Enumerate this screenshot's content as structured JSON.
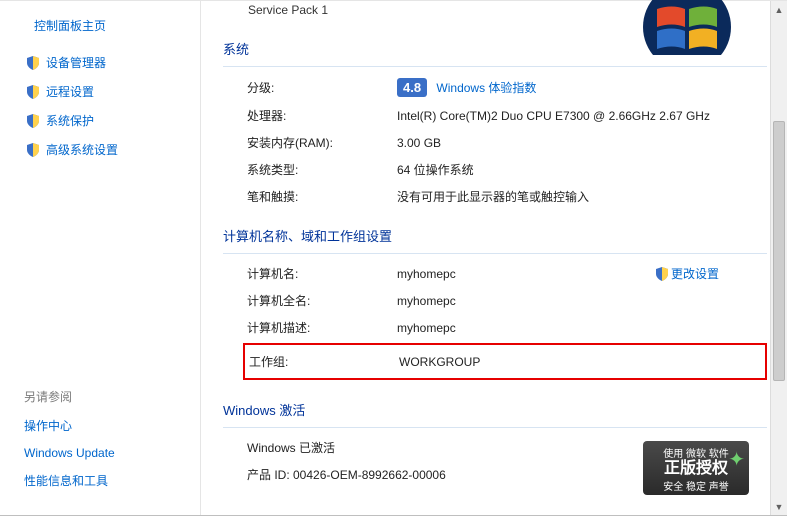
{
  "sidebar": {
    "home": "控制面板主页",
    "links": [
      "设备管理器",
      "远程设置",
      "系统保护",
      "高级系统设置"
    ],
    "see_also": "另请参阅",
    "bottom": [
      "操作中心",
      "Windows Update",
      "性能信息和工具"
    ]
  },
  "top_partial": "Service Pack 1",
  "sections": {
    "system": {
      "header": "系统",
      "rating_label": "分级:",
      "rating_value": "4.8",
      "rating_link": "Windows 体验指数",
      "rows": [
        {
          "label": "处理器:",
          "value": "Intel(R) Core(TM)2 Duo CPU     E7300  @ 2.66GHz   2.67 GHz"
        },
        {
          "label": "安装内存(RAM):",
          "value": "3.00 GB"
        },
        {
          "label": "系统类型:",
          "value": "64 位操作系统"
        },
        {
          "label": "笔和触摸:",
          "value": "没有可用于此显示器的笔或触控输入"
        }
      ]
    },
    "computer": {
      "header": "计算机名称、域和工作组设置",
      "change_settings": "更改设置",
      "rows": [
        {
          "label": "计算机名:",
          "value": "myhomepc"
        },
        {
          "label": "计算机全名:",
          "value": "myhomepc"
        },
        {
          "label": "计算机描述:",
          "value": "myhomepc"
        }
      ],
      "workgroup": {
        "label": "工作组:",
        "value": "WORKGROUP"
      }
    },
    "activation": {
      "header": "Windows 激活",
      "status": "Windows 已激活",
      "product_id": "产品 ID: 00426-OEM-8992662-00006"
    }
  },
  "badge": {
    "line1": "使用 微软 软件",
    "line2": "正版授权",
    "line3": "安全 稳定 声誉"
  }
}
